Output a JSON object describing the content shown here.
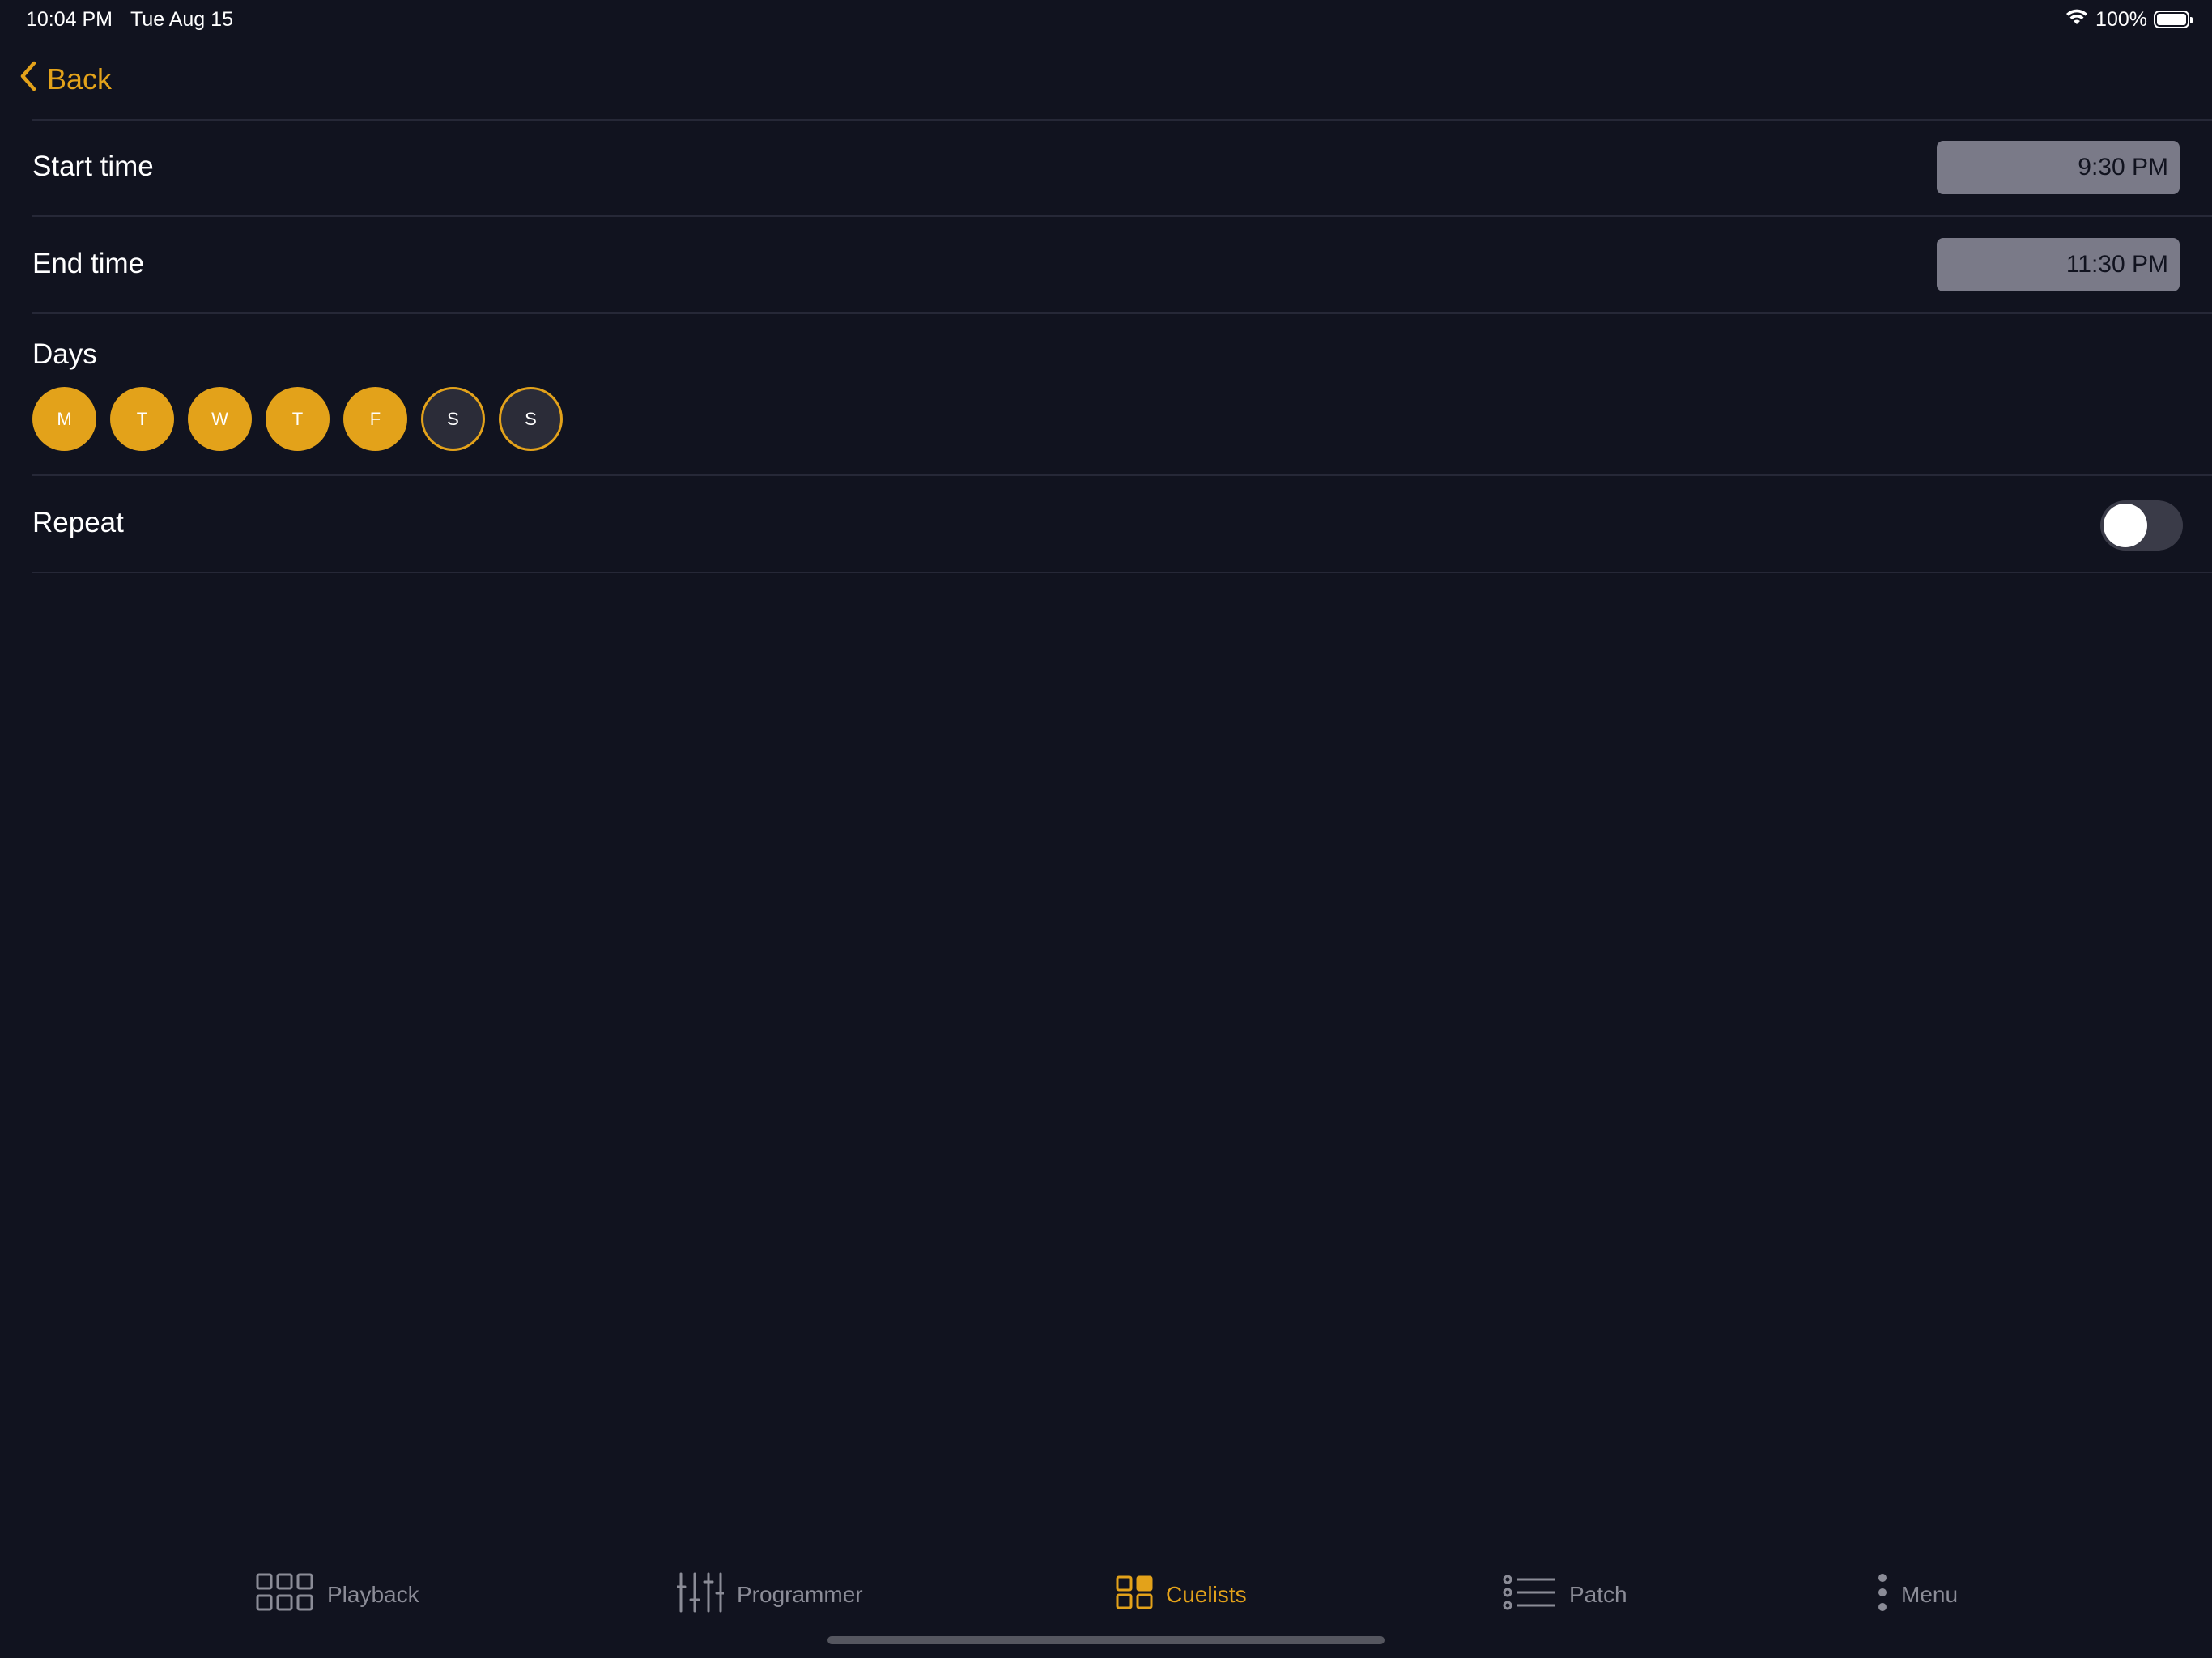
{
  "status_bar": {
    "time": "10:04 PM",
    "date": "Tue Aug 15",
    "battery": "100%",
    "icons": [
      "wifi-icon",
      "battery-icon"
    ]
  },
  "nav": {
    "back_label": "Back",
    "back_icon": "chevron-left-icon"
  },
  "schedule": {
    "start_time": {
      "label": "Start time",
      "value": "9:30 PM"
    },
    "end_time": {
      "label": "End time",
      "value": "11:30 PM"
    },
    "days": {
      "label": "Days",
      "items": [
        {
          "label": "M",
          "selected": true
        },
        {
          "label": "T",
          "selected": true
        },
        {
          "label": "W",
          "selected": true
        },
        {
          "label": "T",
          "selected": true
        },
        {
          "label": "F",
          "selected": true
        },
        {
          "label": "S",
          "selected": false
        },
        {
          "label": "S",
          "selected": false
        }
      ]
    },
    "repeat": {
      "label": "Repeat",
      "enabled": false
    }
  },
  "tabbar": {
    "tabs": [
      {
        "label": "Playback",
        "icon": "grid-icon",
        "active": false
      },
      {
        "label": "Programmer",
        "icon": "sliders-icon",
        "active": false
      },
      {
        "label": "Cuelists",
        "icon": "cuelists-icon",
        "active": true
      },
      {
        "label": "Patch",
        "icon": "list-icon",
        "active": false
      },
      {
        "label": "Menu",
        "icon": "more-vertical-icon",
        "active": false
      }
    ]
  },
  "colors": {
    "background": "#11131f",
    "accent": "#e3a21a",
    "field": "#7a7a88",
    "divider": "#262837",
    "inactive": "#8b8c97"
  }
}
